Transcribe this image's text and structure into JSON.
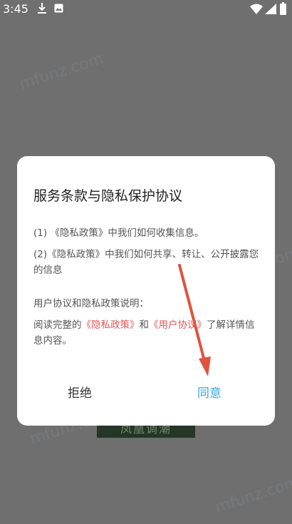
{
  "status_bar": {
    "time": "3:45",
    "icons": [
      "download-icon",
      "photo-icon",
      "wifi-icon",
      "signal-icon",
      "battery-icon"
    ]
  },
  "background": {
    "banner_text": "凤凰调潮"
  },
  "dialog": {
    "title": "服务条款与隐私保护协议",
    "paragraph1": "(1) 《隐私政策》中我们如何收集信息。",
    "paragraph2": "(2)《隐私政策》中我们如何共享、转让、公开披露您的信息",
    "paragraph3": "用户协议和隐私政策说明：",
    "paragraph4": {
      "prefix": "阅读完整的",
      "privacy_link": "《隐私政策》",
      "and": "和",
      "user_link": "《用户协议》",
      "suffix": "了解详情信息内容。"
    },
    "reject_label": "拒绝",
    "agree_label": "同意"
  },
  "watermark": "mfunz.com",
  "colors": {
    "link": "#e05757",
    "agree": "#3ba9dc",
    "arrow": "#e0533f",
    "overlay": "#6f6f6f"
  }
}
